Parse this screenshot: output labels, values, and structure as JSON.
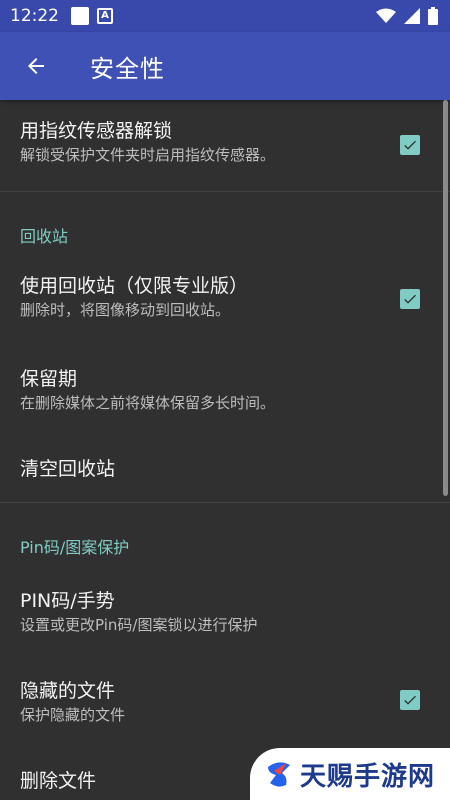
{
  "status_bar": {
    "time": "12:22",
    "icons": [
      "square-notification-icon",
      "a-notification-icon",
      "wifi-icon",
      "cell-signal-icon",
      "battery-icon"
    ]
  },
  "app_bar": {
    "title": "安全性",
    "back_icon": "arrow-left-icon"
  },
  "fingerprint": {
    "title": "用指纹传感器解锁",
    "subtitle": "解锁受保护文件夹时启用指纹传感器。",
    "checked": true
  },
  "recycle_section": {
    "header": "回收站"
  },
  "use_recycle": {
    "title": "使用回收站（仅限专业版）",
    "subtitle": "删除时，将图像移动到回收站。",
    "checked": true
  },
  "retention": {
    "title": "保留期",
    "subtitle": "在删除媒体之前将媒体保留多长时间。"
  },
  "empty_recycle": {
    "title": "清空回收站"
  },
  "pin_section": {
    "header": "Pin码/图案保护"
  },
  "pin": {
    "title": "PIN码/手势",
    "subtitle": "设置或更改Pin码/图案锁以进行保护"
  },
  "hidden_files": {
    "title": "隐藏的文件",
    "subtitle": "保护隐藏的文件",
    "checked": true
  },
  "delete_files": {
    "title": "删除文件"
  },
  "watermark": {
    "text": "天赐手游网"
  },
  "colors": {
    "status_bar": "#3949AB",
    "app_bar": "#3F51B5",
    "background": "#303030",
    "accent": "#80CBC4"
  }
}
